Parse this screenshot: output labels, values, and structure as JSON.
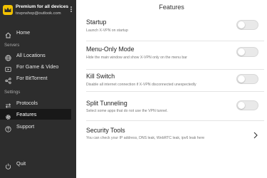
{
  "account": {
    "title": "Premium for all devices",
    "email": "txvpnshop@outlook.com"
  },
  "sidebar": {
    "home": "Home",
    "servers_heading": "Servers",
    "servers": [
      "All Locations",
      "For Game & Video",
      "For BitTorrent"
    ],
    "settings_heading": "Settings",
    "settings": [
      "Protocols",
      "Features",
      "Support"
    ],
    "quit": "Quit",
    "active_item": "Features"
  },
  "page": {
    "title": "Features"
  },
  "features": [
    {
      "title": "Startup",
      "desc": "Launch X-VPN on startup",
      "enabled": false
    },
    {
      "title": "Menu-Only Mode",
      "desc": "Hide the main window and show X-VPN only on the menu bar",
      "enabled": false
    },
    {
      "title": "Kill Switch",
      "desc": "Disable all internet connection if X-VPN disconnected unexpectedly",
      "enabled": false
    },
    {
      "title": "Split Tunneling",
      "desc": "Select some apps that do not use the VPN tunnel.",
      "enabled": false
    },
    {
      "title": "Security Tools",
      "desc": "You can check your IP address, DNS leak, WebRTC leak, ipv6 leak here"
    }
  ],
  "colors": {
    "sidebar_bg": "#2d2d2d",
    "active_bg": "#181818",
    "brand_yellow": "#f2c200",
    "toggle_off": "#e9e9e9"
  },
  "icons": {
    "brand": "crown-icon",
    "home": "home-icon",
    "all_locations": "globe-icon",
    "game_video": "play-icon",
    "bittorrent": "share-icon",
    "protocols": "swap-arrows-icon",
    "features": "gear-icon",
    "support": "help-circle-icon",
    "quit": "power-icon"
  }
}
